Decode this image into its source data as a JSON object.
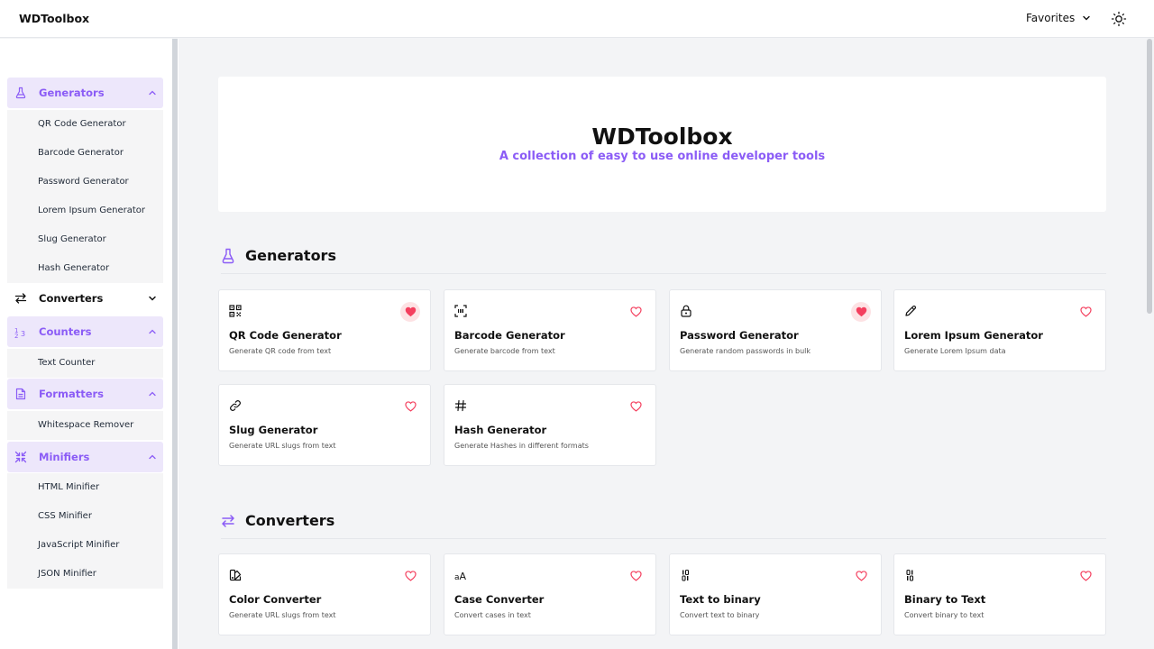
{
  "header": {
    "brand": "WDToolbox",
    "favorites_label": "Favorites",
    "theme_icon": "sun-icon"
  },
  "sidebar": {
    "groups": [
      {
        "label": "Generators",
        "icon": "flask-icon",
        "expanded": true,
        "items": [
          "QR Code Generator",
          "Barcode Generator",
          "Password Generator",
          "Lorem Ipsum Generator",
          "Slug Generator",
          "Hash Generator"
        ]
      },
      {
        "label": "Converters",
        "icon": "arrows-swap-icon",
        "expanded": false,
        "items": []
      },
      {
        "label": "Counters",
        "icon": "counter-icon",
        "expanded": true,
        "items": [
          "Text Counter"
        ]
      },
      {
        "label": "Formatters",
        "icon": "document-icon",
        "expanded": true,
        "items": [
          "Whitespace Remover"
        ]
      },
      {
        "label": "Minifiers",
        "icon": "compress-icon",
        "expanded": true,
        "items": [
          "HTML Minifier",
          "CSS Minifier",
          "JavaScript Minifier",
          "JSON Minifier"
        ]
      }
    ]
  },
  "hero": {
    "title": "WDToolbox",
    "subtitle": "A collection of easy to use online developer tools"
  },
  "sections": [
    {
      "title": "Generators",
      "icon": "flask-icon",
      "cards": [
        {
          "title": "QR Code Generator",
          "desc": "Generate QR code from text",
          "icon": "qr-code-icon",
          "favorite": true
        },
        {
          "title": "Barcode Generator",
          "desc": "Generate barcode from text",
          "icon": "barcode-icon",
          "favorite": false
        },
        {
          "title": "Password Generator",
          "desc": "Generate random passwords in bulk",
          "icon": "lock-icon",
          "favorite": true
        },
        {
          "title": "Lorem Ipsum Generator",
          "desc": "Generate Lorem Ipsum data",
          "icon": "pencil-icon",
          "favorite": false
        },
        {
          "title": "Slug Generator",
          "desc": "Generate URL slugs from text",
          "icon": "link-icon",
          "favorite": false
        },
        {
          "title": "Hash Generator",
          "desc": "Generate Hashes in different formats",
          "icon": "hash-icon",
          "favorite": false
        }
      ]
    },
    {
      "title": "Converters",
      "icon": "arrows-swap-icon",
      "cards": [
        {
          "title": "Color Converter",
          "desc": "Generate URL slugs from text",
          "icon": "color-swatch-icon",
          "favorite": false
        },
        {
          "title": "Case Converter",
          "desc": "Convert cases in text",
          "icon": "case-icon",
          "favorite": false
        },
        {
          "title": "Text to binary",
          "desc": "Convert text to binary",
          "icon": "binary-icon",
          "favorite": false
        },
        {
          "title": "Binary to Text",
          "desc": "Convert binary to text",
          "icon": "binary-icon",
          "favorite": false
        }
      ]
    }
  ],
  "colors": {
    "accent": "#8b5cf6",
    "accent_bg": "#ede7fb",
    "heart": "#f43f5e",
    "page_bg": "#f3f4f6"
  }
}
